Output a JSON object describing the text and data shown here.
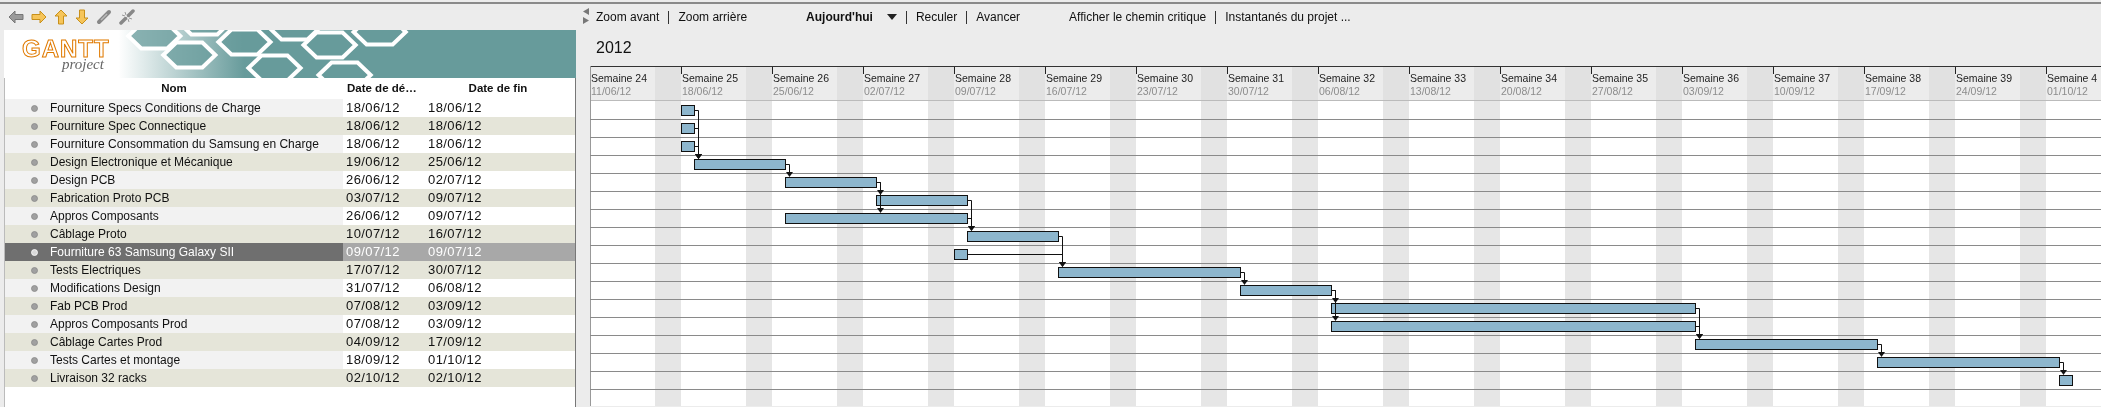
{
  "logo": {
    "title": "GANTT",
    "subtitle": "project"
  },
  "table": {
    "columns": [
      "Nom",
      "Date de dé…",
      "Date de fin"
    ]
  },
  "tasks": [
    {
      "name": "Fourniture Specs Conditions de Charge",
      "start": "18/06/12",
      "end": "18/06/12",
      "selected": false
    },
    {
      "name": "Fourniture Spec Connectique",
      "start": "18/06/12",
      "end": "18/06/12",
      "selected": false
    },
    {
      "name": "Fourniture Consommation du Samsung en Charge",
      "start": "18/06/12",
      "end": "18/06/12",
      "selected": false
    },
    {
      "name": "Design Electronique et Mécanique",
      "start": "19/06/12",
      "end": "25/06/12",
      "selected": false
    },
    {
      "name": "Design PCB",
      "start": "26/06/12",
      "end": "02/07/12",
      "selected": false
    },
    {
      "name": "Fabrication Proto PCB",
      "start": "03/07/12",
      "end": "09/07/12",
      "selected": false
    },
    {
      "name": "Appros Composants",
      "start": "26/06/12",
      "end": "09/07/12",
      "selected": false
    },
    {
      "name": "Câblage Proto",
      "start": "10/07/12",
      "end": "16/07/12",
      "selected": false
    },
    {
      "name": "Fourniture 63 Samsung Galaxy SII",
      "start": "09/07/12",
      "end": "09/07/12",
      "selected": true
    },
    {
      "name": "Tests Electriques",
      "start": "17/07/12",
      "end": "30/07/12",
      "selected": false
    },
    {
      "name": "Modifications Design",
      "start": "31/07/12",
      "end": "06/08/12",
      "selected": false
    },
    {
      "name": "Fab PCB Prod",
      "start": "07/08/12",
      "end": "03/09/12",
      "selected": false
    },
    {
      "name": "Appros Composants Prod",
      "start": "07/08/12",
      "end": "03/09/12",
      "selected": false
    },
    {
      "name": "Câblage Cartes Prod",
      "start": "04/09/12",
      "end": "17/09/12",
      "selected": false
    },
    {
      "name": "Tests Cartes et montage",
      "start": "18/09/12",
      "end": "01/10/12",
      "selected": false
    },
    {
      "name": "Livraison 32 racks",
      "start": "02/10/12",
      "end": "02/10/12",
      "selected": false
    }
  ],
  "chart_toolbar": [
    [
      {
        "label": "Zoom avant",
        "kind": "button"
      },
      {
        "label": "Zoom arrière",
        "kind": "button"
      }
    ],
    [
      {
        "label": "Aujourd'hui",
        "kind": "dropdown"
      },
      {
        "label": "Reculer",
        "kind": "button"
      },
      {
        "label": "Avancer",
        "kind": "button"
      }
    ],
    [
      {
        "label": "Afficher le chemin critique",
        "kind": "button"
      },
      {
        "label": "Instantanés du projet ...",
        "kind": "button"
      }
    ]
  ],
  "year": "2012",
  "weeks": [
    {
      "label": "Semaine 24",
      "date": "11/06/12"
    },
    {
      "label": "Semaine 25",
      "date": "18/06/12"
    },
    {
      "label": "Semaine 26",
      "date": "25/06/12"
    },
    {
      "label": "Semaine 27",
      "date": "02/07/12"
    },
    {
      "label": "Semaine 28",
      "date": "09/07/12"
    },
    {
      "label": "Semaine 29",
      "date": "16/07/12"
    },
    {
      "label": "Semaine 30",
      "date": "23/07/12"
    },
    {
      "label": "Semaine 31",
      "date": "30/07/12"
    },
    {
      "label": "Semaine 32",
      "date": "06/08/12"
    },
    {
      "label": "Semaine 33",
      "date": "13/08/12"
    },
    {
      "label": "Semaine 34",
      "date": "20/08/12"
    },
    {
      "label": "Semaine 35",
      "date": "27/08/12"
    },
    {
      "label": "Semaine 36",
      "date": "03/09/12"
    },
    {
      "label": "Semaine 37",
      "date": "10/09/12"
    },
    {
      "label": "Semaine 38",
      "date": "17/09/12"
    },
    {
      "label": "Semaine 39",
      "date": "24/09/12"
    },
    {
      "label": "Semaine 4",
      "date": "01/10/12"
    }
  ]
}
